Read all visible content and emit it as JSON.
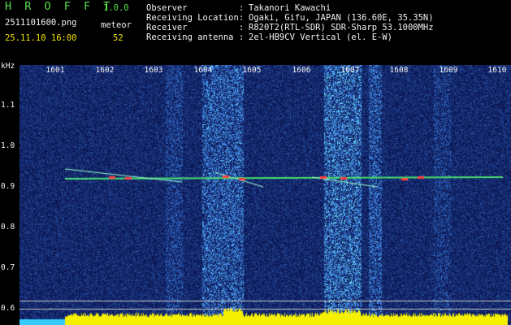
{
  "app": {
    "title": "H R O F F T",
    "version": "1.0.0"
  },
  "file": {
    "name": "2511101600.png",
    "datetime": "25.11.10 16:00"
  },
  "counter": {
    "label": "meteor",
    "value": "52"
  },
  "info": [
    {
      "label": "Observer",
      "sep": ":",
      "value": "Takanori Kawachi"
    },
    {
      "label": "Receiving Location",
      "sep": ":",
      "value": "Ogaki, Gifu, JAPAN (136.60E, 35.35N)"
    },
    {
      "label": "Receiver",
      "sep": ":",
      "value": "R820T2(RTL-SDR) SDR-Sharp 53.1000MHz"
    },
    {
      "label": "Receiving antenna",
      "sep": ":",
      "value": "2el-HB9CV Vertical (el. E-W)"
    }
  ],
  "axis": {
    "unit": "kHz",
    "y_ticks": [
      "1.1",
      "1.0",
      "0.9",
      "0.8",
      "0.7",
      "0.6"
    ],
    "x_ticks": [
      "1601",
      "1602",
      "1603",
      "1604",
      "1605",
      "1606",
      "1607",
      "1608",
      "1609",
      "1610"
    ]
  },
  "colors": {
    "header_green": "#56e04a",
    "header_yellow": "#f0e000",
    "background": "#000000",
    "spectrum_low": "#0a1a6e",
    "spectrum_mid": "#2a9cff",
    "spectrum_high": "#ff3030",
    "level_bar": "#f5f000",
    "baseline_bar": "#33ccff"
  }
}
